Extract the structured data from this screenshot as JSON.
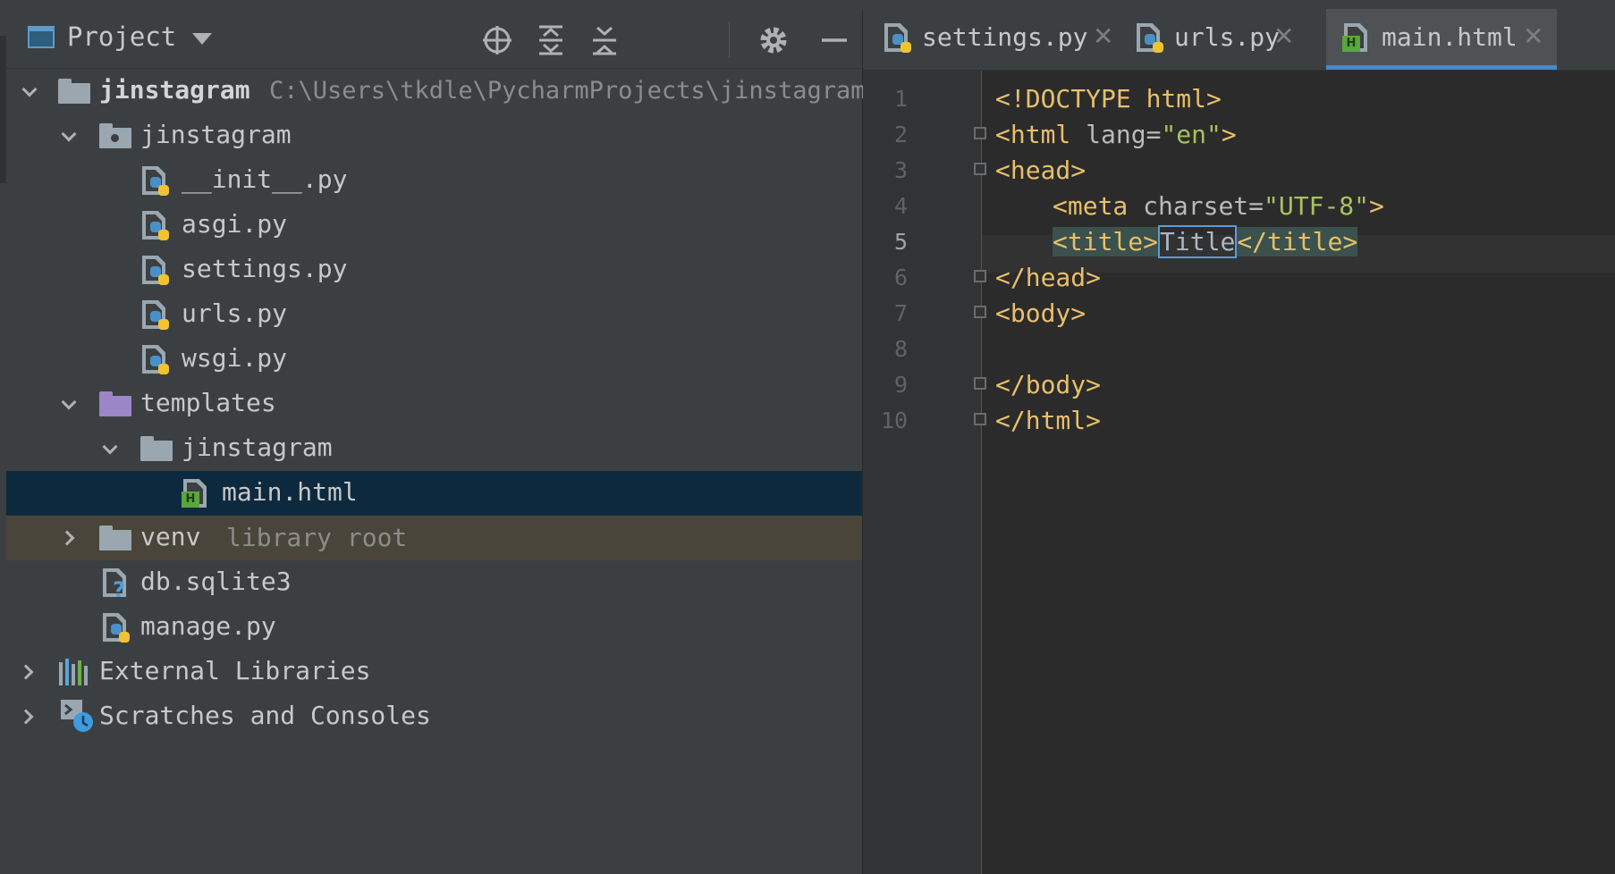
{
  "project_panel": {
    "title": "Project",
    "tree": [
      {
        "name": "jinstagram",
        "path": "C:\\Users\\tkdle\\PycharmProjects\\jinstagram"
      },
      {
        "name": "jinstagram"
      },
      {
        "name": "__init__.py"
      },
      {
        "name": "asgi.py"
      },
      {
        "name": "settings.py"
      },
      {
        "name": "urls.py"
      },
      {
        "name": "wsgi.py"
      },
      {
        "name": "templates"
      },
      {
        "name": "jinstagram"
      },
      {
        "name": "main.html"
      },
      {
        "name": "venv",
        "hint": "library root"
      },
      {
        "name": "db.sqlite3"
      },
      {
        "name": "manage.py"
      },
      {
        "name": "External Libraries"
      },
      {
        "name": "Scratches and Consoles"
      }
    ]
  },
  "editor": {
    "tabs": [
      {
        "label": "settings.py"
      },
      {
        "label": "urls.py"
      },
      {
        "label": "main.html"
      }
    ],
    "active_tab": "main.html",
    "line_numbers": [
      "1",
      "2",
      "3",
      "4",
      "5",
      "6",
      "7",
      "8",
      "9",
      "10"
    ],
    "code": {
      "l1": "<!DOCTYPE html>",
      "l2_open": "<html ",
      "l2_attr": "lang=",
      "l2_val": "\"en\"",
      "l2_close": ">",
      "l3": "<head>",
      "l4_open": "<meta ",
      "l4_attr": "charset=",
      "l4_val": "\"UTF-8\"",
      "l4_close": ">",
      "l5_open": "<title>",
      "l5_text": "Title",
      "l5_close": "</title>",
      "l6": "</head>",
      "l7": "<body>",
      "l9": "</body>",
      "l10": "</html>"
    }
  },
  "colors": {
    "panel_bg": "#3c3f41",
    "editor_bg": "#2b2b2b",
    "selection": "#0d293e",
    "active_tab_underline": "#4a88c7",
    "tag": "#e8bf6a",
    "string": "#a5c261"
  }
}
